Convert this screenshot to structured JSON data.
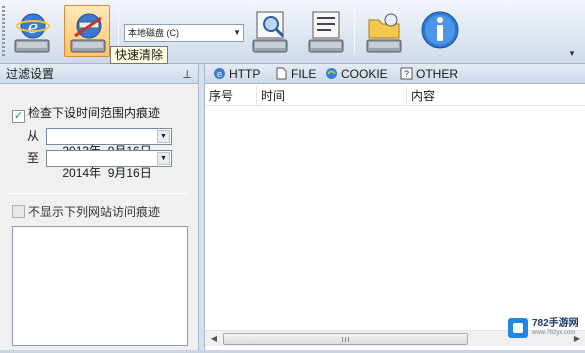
{
  "toolbar": {
    "drive_select_value": "本地磁盘 (C)",
    "tooltip": "快速清除",
    "buttons": [
      "ie-history-icon",
      "quick-clear-icon",
      "drive-scan-icon",
      "drive-report-icon",
      "folder-open-icon",
      "info-icon"
    ]
  },
  "filter_panel": {
    "title": "过滤设置",
    "check_time_range_label": "检查下设时间范围内痕迹",
    "check_time_range_checked": true,
    "from_label": "从",
    "from_date": "2013年  9月16日",
    "to_label": "至",
    "to_date": "2014年  9月16日",
    "hide_sites_label": "不显示下列网站访问痕迹",
    "hide_sites_checked": false
  },
  "tabs": [
    {
      "label": "HTTP",
      "icon": "ie-icon"
    },
    {
      "label": "FILE",
      "icon": "file-icon"
    },
    {
      "label": "COOKIE",
      "icon": "cookie-icon"
    },
    {
      "label": "OTHER",
      "icon": "help-icon"
    }
  ],
  "grid": {
    "columns": [
      "序号",
      "时间",
      "内容"
    ],
    "rows": []
  },
  "watermark": {
    "title": "782手游网",
    "sub": "www.782yx.com"
  },
  "colors": {
    "toolbar_bg": "#dfe7f2",
    "active_button": "#ffc46a",
    "tooltip_bg": "#ffffe1",
    "panel_bg": "#f0f0f0"
  }
}
